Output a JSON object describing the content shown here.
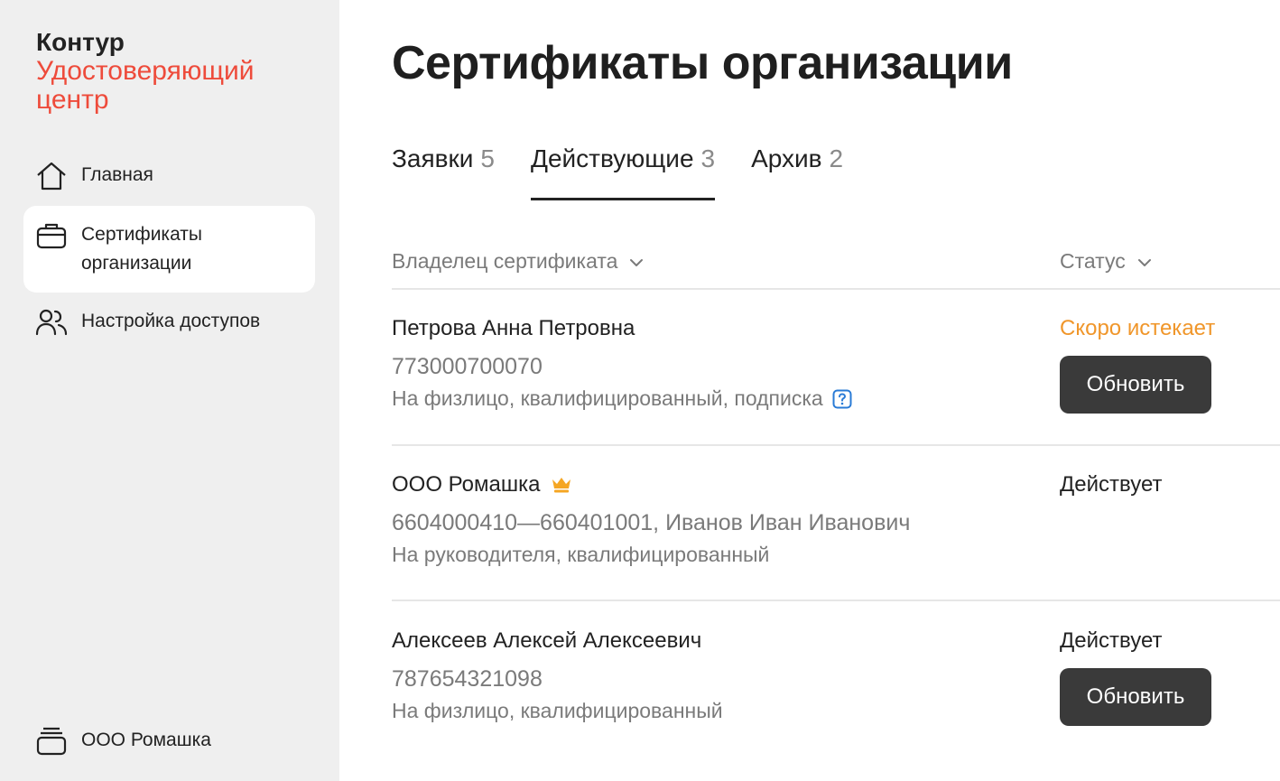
{
  "brand": {
    "name": "Контур",
    "product": "Удостоверяющий центр",
    "accent_color": "#ee4b3b"
  },
  "sidebar": {
    "items": [
      {
        "label": "Главная",
        "icon": "home-icon",
        "active": false
      },
      {
        "label": "Сертификаты организации",
        "icon": "briefcase-icon",
        "active": true
      },
      {
        "label": "Настройка доступов",
        "icon": "users-icon",
        "active": false
      }
    ],
    "org": {
      "label": "ООО Ромашка",
      "icon": "stack-icon"
    }
  },
  "main": {
    "title": "Сертификаты организации",
    "tabs": [
      {
        "label": "Заявки",
        "count": "5",
        "active": false
      },
      {
        "label": "Действующие",
        "count": "3",
        "active": true
      },
      {
        "label": "Архив",
        "count": "2",
        "active": false
      }
    ],
    "columns": {
      "owner": "Владелец сертификата",
      "status": "Статус"
    },
    "rows": [
      {
        "name": "Петрова Анна Петровна",
        "id": "773000700070",
        "type": "На физлицо, квалифицированный, подписка",
        "status": "Скоро истекает",
        "status_color": "#f0962a",
        "action": "Обновить",
        "help_icon": "question-icon"
      },
      {
        "name": "ООО Ромашка",
        "name_icon": "crown-icon",
        "id": "6604000410—660401001, Иванов Иван Иванович",
        "type": "На руководителя, квалифицированный",
        "status": "Действует",
        "status_color": "#222222"
      },
      {
        "name": "Алексеев Алексей Алексеевич",
        "id": "787654321098",
        "type": "На физлицо, квалифицированный",
        "status": "Действует",
        "status_color": "#222222",
        "action": "Обновить"
      }
    ]
  }
}
